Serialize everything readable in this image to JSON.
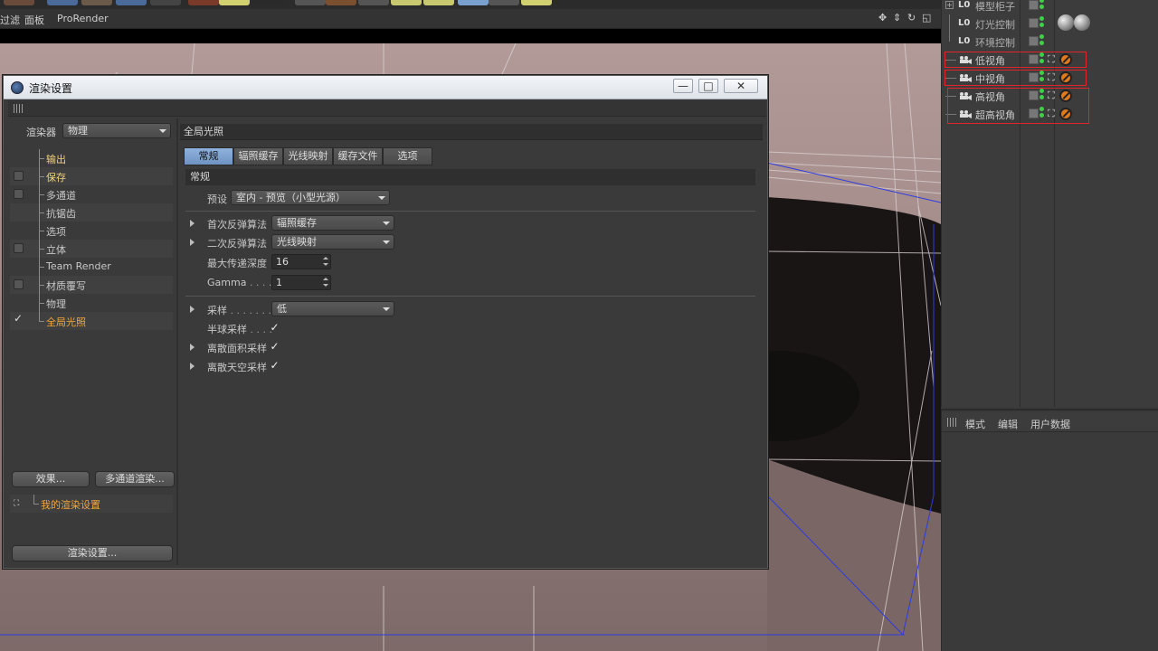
{
  "menubar": {
    "items": [
      "过滤",
      "面板",
      "ProRender"
    ]
  },
  "object_manager": {
    "objects": [
      {
        "label": "模型柜子",
        "type": "null"
      },
      {
        "label": "灯光控制",
        "type": "null"
      },
      {
        "label": "环境控制",
        "type": "null"
      },
      {
        "label": "低视角",
        "type": "camera"
      },
      {
        "label": "中视角",
        "type": "camera"
      },
      {
        "label": "高视角",
        "type": "camera"
      },
      {
        "label": "超高视角",
        "type": "camera"
      }
    ],
    "highlight_color": "#e0242a"
  },
  "attributes": {
    "menu": [
      "模式",
      "编辑",
      "用户数据"
    ]
  },
  "dialog": {
    "title": "渲染设置",
    "window_buttons": [
      "—",
      "□",
      "✕"
    ],
    "renderer_label": "渲染器",
    "renderer_value": "物理",
    "nav": [
      {
        "label": "输出",
        "checkbox": "none",
        "style": "yellow"
      },
      {
        "label": "保存",
        "checkbox": "box",
        "style": "yellow"
      },
      {
        "label": "多通道",
        "checkbox": "box",
        "style": "normal"
      },
      {
        "label": "抗锯齿",
        "checkbox": "none",
        "style": "normal"
      },
      {
        "label": "选项",
        "checkbox": "none",
        "style": "normal"
      },
      {
        "label": "立体",
        "checkbox": "box",
        "style": "normal"
      },
      {
        "label": "Team Render",
        "checkbox": "none",
        "style": "normal"
      },
      {
        "label": "材质覆写",
        "checkbox": "box",
        "style": "normal"
      },
      {
        "label": "物理",
        "checkbox": "none",
        "style": "normal"
      },
      {
        "label": "全局光照",
        "checkbox": "checked",
        "style": "orange"
      }
    ],
    "effects_button": "效果...",
    "multipass_button": "多通道渲染...",
    "preset_name": "我的渲染设置",
    "render_settings_button": "渲染设置...",
    "section_title": "全局光照",
    "tabs": [
      "常规",
      "辐照缓存",
      "光线映射",
      "缓存文件",
      "选项"
    ],
    "active_tab": "常规",
    "sub_title": "常规",
    "preset_label": "预设",
    "preset_value": "室内 - 预览（小型光源）",
    "primary_label": "首次反弹算法",
    "primary_value": "辐照缓存",
    "secondary_label": "二次反弹算法",
    "secondary_value": "光线映射",
    "depth_label": "最大传递深度",
    "depth_value": "16",
    "gamma_label": "Gamma",
    "gamma_dots": ". . . .",
    "gamma_value": "1",
    "sampling_label": "采样",
    "sampling_dots": ". . . . . . .",
    "sampling_value": "低",
    "hemi_label": "半球采样",
    "hemi_dots": ". . . .",
    "hemi_checked": "✓",
    "area_label": "离散面积采样",
    "area_checked": "✓",
    "sky_label": "离散天空采样",
    "sky_checked": "✓"
  }
}
